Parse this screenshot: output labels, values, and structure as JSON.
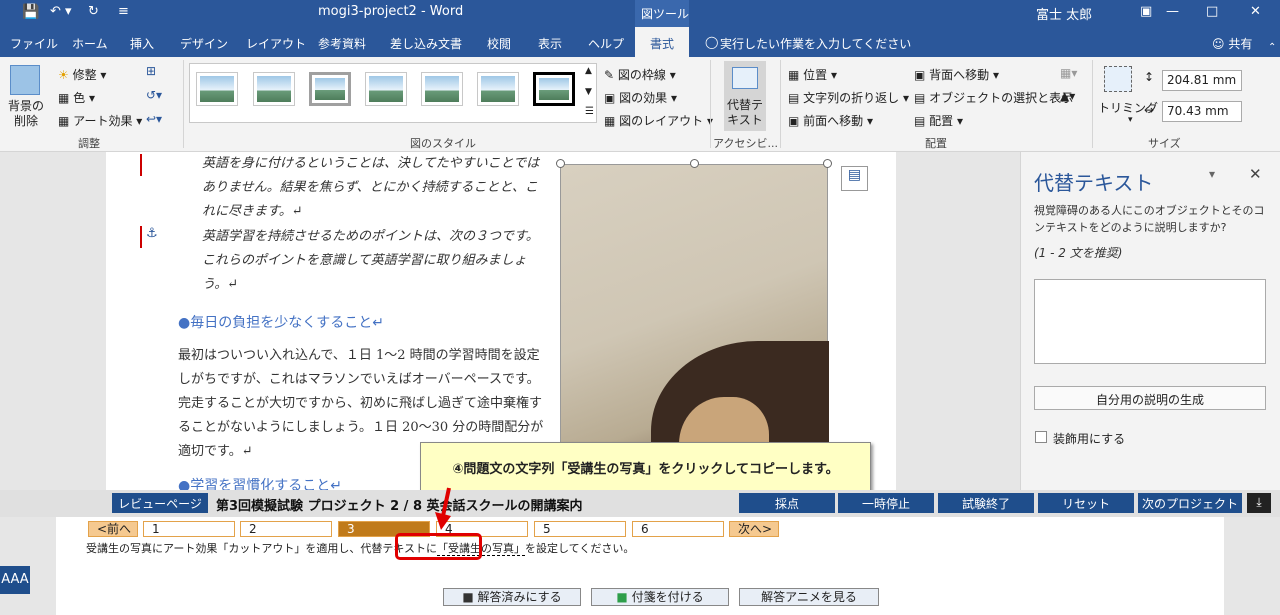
{
  "title_bar": {
    "doc_title": "mogi3-project2  -  Word",
    "context_label": "図ツール",
    "user": "富士 太郎"
  },
  "tabs": [
    "ファイル",
    "ホーム",
    "挿入",
    "デザイン",
    "レイアウト",
    "参考資料",
    "差し込み文書",
    "校閲",
    "表示",
    "ヘルプ",
    "書式"
  ],
  "tell_me": "実行したい作業を入力してください",
  "share": "共有",
  "ribbon": {
    "adjust": {
      "remove_bg": "背景の削除",
      "corrections": "修整",
      "color": "色",
      "art_effects": "アート効果",
      "group": "調整"
    },
    "styles": {
      "border": "図の枠線",
      "effects": "図の効果",
      "layout": "図のレイアウト",
      "group": "図のスタイル"
    },
    "access": {
      "alt_text": "代替テキスト",
      "group": "アクセシビ..."
    },
    "arrange": {
      "position": "位置",
      "wrap": "文字列の折り返し",
      "forward": "前面へ移動",
      "backward": "背面へ移動",
      "selection": "オブジェクトの選択と表示",
      "align": "配置",
      "group": "配置"
    },
    "size": {
      "crop": "トリミング",
      "height": "204.81 mm",
      "width": "70.43 mm",
      "group": "サイズ"
    }
  },
  "document": {
    "para1": "英語を身に付けるということは、決してたやすいことではありません。結果を焦らず、とにかく持続することと、これに尽きます。↵",
    "para2": "英語学習を持続させるためのポイントは、次の３つです。これらのポイントを意識して英語学習に取り組みましょう。↵",
    "heading1": "●毎日の負担を少なくすること↵",
    "para3": "最初はついつい入れ込んで、１日 1～2 時間の学習時間を設定しがちですが、これはマラソンでいえばオーバーペースです。完走することが大切ですから、初めに飛ばし過ぎて途中棄権することがないようにしましょう。１日 20～30 分の時間配分が適切です。↵",
    "heading2": "●学習を習慣化すること↵"
  },
  "pane": {
    "title": "代替テキスト",
    "desc": "視覚障碍のある人にこのオブジェクトとそのコンテキストをどのように説明しますか?",
    "hint": "(1 - 2 文を推奨)",
    "generate": "自分用の説明の生成",
    "decorative": "装飾用にする"
  },
  "callout": "④問題文の文字列「受講生の写真」をクリックしてコピーします。",
  "exam_bar": {
    "review": "レビューページ",
    "title": "第3回模擬試験 プロジェクト 2 / 8 英会話スクールの開講案内",
    "buttons": [
      "採点",
      "一時停止",
      "試験終了",
      "リセット",
      "次のプロジェクト"
    ]
  },
  "steps": {
    "prev": "<前へ",
    "items": [
      "1",
      "2",
      "3",
      "4",
      "5",
      "6"
    ],
    "next": "次へ>",
    "current": "3"
  },
  "task": {
    "before": "受講生の写真にアート効果「カットアウト」を適用し、代替テキストに",
    "highlight": "「受講生の写真」",
    "after": "を設定してください。"
  },
  "actions": {
    "done": "解答済みにする",
    "flag": "付箋を付ける",
    "anime": "解答アニメを見る"
  },
  "font_size_btn": "AAA",
  "colors": {
    "word_blue": "#2b579a",
    "exam_blue": "#1f4e8c",
    "step_active": "#c07a1a",
    "highlight_red": "#e00000"
  }
}
